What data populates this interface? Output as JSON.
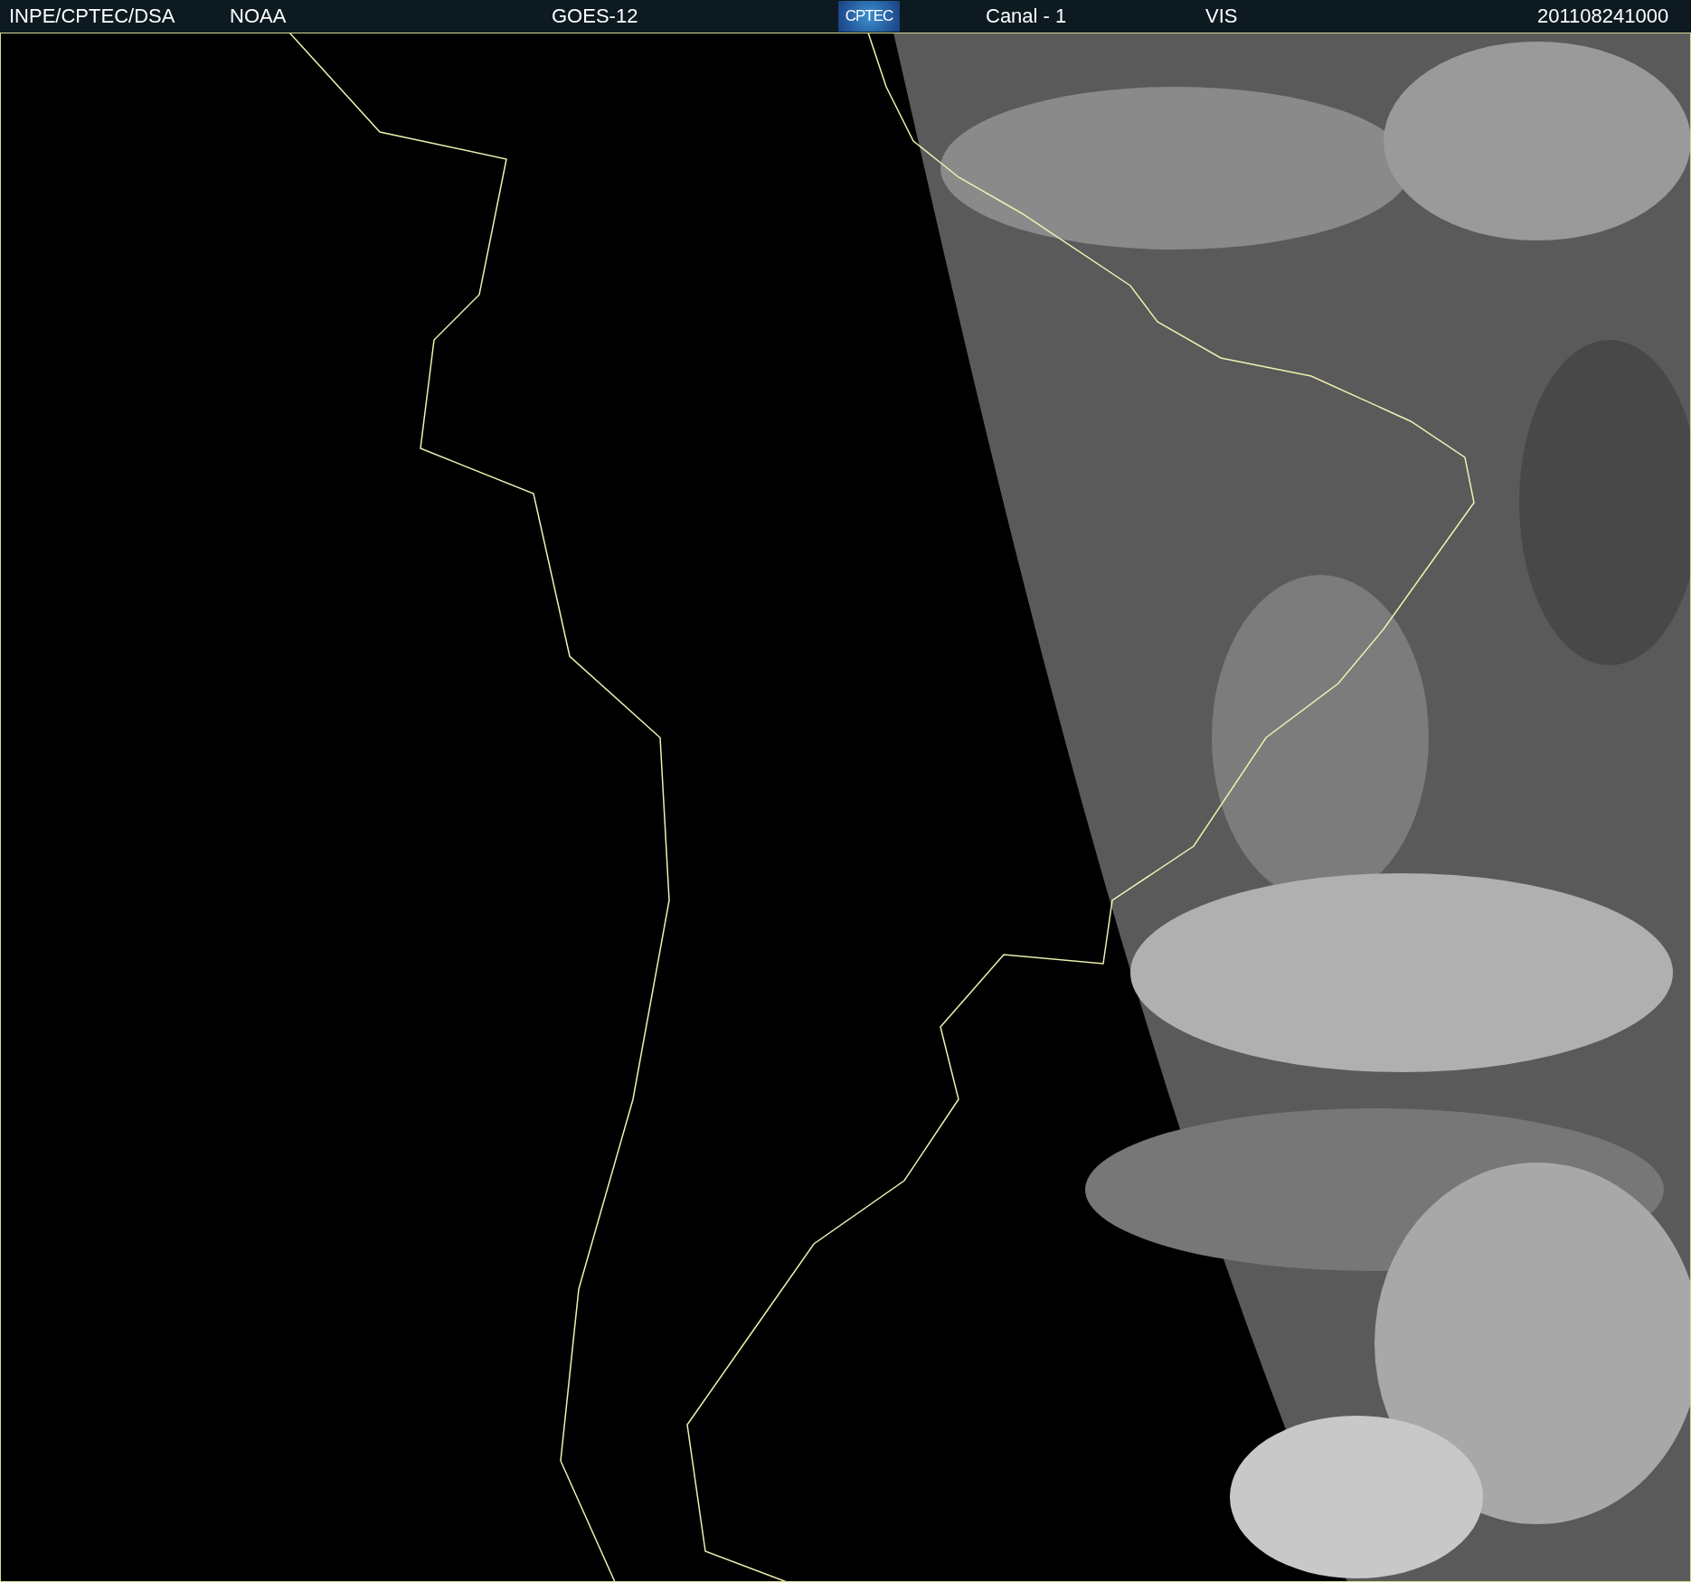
{
  "header": {
    "items": [
      {
        "kind": "text",
        "text": "INPE/CPTEC/DSA"
      },
      {
        "kind": "text",
        "text": "NOAA"
      },
      {
        "kind": "text",
        "text": "GOES-12"
      },
      {
        "kind": "logo",
        "text": "CPTEC"
      },
      {
        "kind": "text",
        "text": "Canal - 1"
      },
      {
        "kind": "text",
        "text": "VIS"
      },
      {
        "kind": "text",
        "text": "201108241000"
      }
    ]
  }
}
